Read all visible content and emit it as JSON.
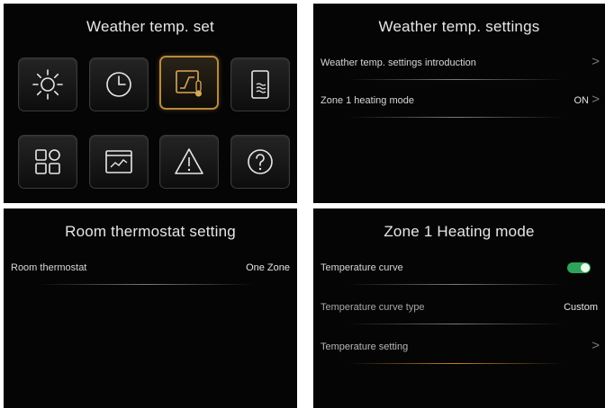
{
  "panel1": {
    "title": "Weather temp. set",
    "tiles": [
      {
        "icon": "sun-icon"
      },
      {
        "icon": "clock-icon"
      },
      {
        "icon": "curve-thermometer-icon",
        "active": true
      },
      {
        "icon": "water-tank-icon"
      },
      {
        "icon": "grid-icon"
      },
      {
        "icon": "chart-window-icon"
      },
      {
        "icon": "warning-icon"
      },
      {
        "icon": "help-icon"
      }
    ]
  },
  "panel2": {
    "title": "Weather temp. settings",
    "rows": [
      {
        "label": "Weather temp. settings introduction",
        "value": "",
        "chevron": ">"
      },
      {
        "label": "Zone 1 heating mode",
        "value": "ON",
        "chevron": ">"
      }
    ]
  },
  "panel3": {
    "title": "Room thermostat setting",
    "rows": [
      {
        "label": "Room thermostat",
        "value": "One Zone"
      }
    ]
  },
  "panel4": {
    "title": "Zone 1 Heating mode",
    "rows": [
      {
        "label": "Temperature curve",
        "toggle": true
      },
      {
        "label": "Temperature curve type",
        "value": "Custom"
      },
      {
        "label": "Temperature setting",
        "chevron": ">"
      }
    ]
  },
  "colors": {
    "active_border": "#b88a3e",
    "toggle_on": "#2fa35a",
    "highlight_line": "#e69628"
  }
}
